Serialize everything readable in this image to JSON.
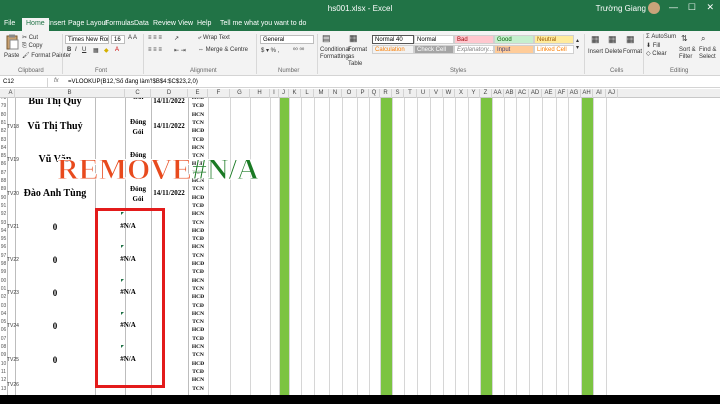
{
  "titlebar": {
    "title": "hs001.xlsx - Excel",
    "user": "Trường Giang",
    "min": "—",
    "max": "☐",
    "close": "✕"
  },
  "tabs": [
    "File",
    "Home",
    "Insert",
    "Page Layout",
    "Formulas",
    "Data",
    "Review",
    "View",
    "Help",
    "Tell me what you want to do"
  ],
  "ribbon": {
    "paste": "Paste",
    "cut": "Cut",
    "copy": "Copy",
    "format_painter": "Format Painter",
    "font_name": "Times New Roman",
    "font_size": "16",
    "wrap_text": "Wrap Text",
    "merge_center": "Merge & Centre",
    "number_format": "General",
    "cond_format": "Conditional Formatting",
    "format_table": "Format as Table",
    "styles": [
      {
        "label": "Normal 40",
        "bg": "#ffffff",
        "fg": "#000000"
      },
      {
        "label": "Normal",
        "bg": "#ffffff",
        "fg": "#000000"
      },
      {
        "label": "Bad",
        "bg": "#ffc7ce",
        "fg": "#9c0006"
      },
      {
        "label": "Good",
        "bg": "#c6efce",
        "fg": "#006100"
      },
      {
        "label": "Neutral",
        "bg": "#ffeb9c",
        "fg": "#9c5700"
      },
      {
        "label": "Calculation",
        "bg": "#f2f2f2",
        "fg": "#fa7d00"
      },
      {
        "label": "Check Cell",
        "bg": "#a5a5a5",
        "fg": "#ffffff"
      },
      {
        "label": "Explanatory...",
        "bg": "#ffffff",
        "fg": "#7f7f7f"
      },
      {
        "label": "Input",
        "bg": "#ffcc99",
        "fg": "#3f3f76"
      },
      {
        "label": "Linked Cell",
        "bg": "#ffffff",
        "fg": "#fa7d00"
      }
    ],
    "insert": "Insert",
    "delete": "Delete",
    "format": "Format",
    "autosum": "AutoSum",
    "fill": "Fill",
    "clear": "Clear",
    "sort_filter": "Sort & Filter",
    "find_select": "Find & Select",
    "groups": [
      "Clipboard",
      "Font",
      "Alignment",
      "Number",
      "Styles",
      "Cells",
      "Editing"
    ]
  },
  "formula_bar": {
    "name_box": "C12",
    "fx": "fx",
    "formula": "=VLOOKUP(B12,'Số đang làm'!$B$4:$C$23,2,0)"
  },
  "columns": [
    "A",
    "B",
    "C",
    "D",
    "E",
    "F",
    "G",
    "H",
    "I",
    "J",
    "K",
    "L",
    "M",
    "N",
    "O",
    "P",
    "Q",
    "R",
    "S",
    "T",
    "U",
    "V",
    "W",
    "X",
    "Y",
    "Z",
    "AA",
    "AB",
    "AC",
    "AD",
    "AE",
    "AF",
    "AG",
    "AH",
    "AI",
    "AJ"
  ],
  "overlay": {
    "remove": "REMOVE",
    "na": "#N/A"
  },
  "rows": [
    {
      "nums": [
        "78",
        "79"
      ],
      "stt": "",
      "name": "Bùi Thị Quý",
      "c": "Gói",
      "date": "14/11/2022",
      "codes": [
        "HCĐ",
        "TCĐ"
      ]
    },
    {
      "nums": [
        "80",
        "81",
        "82",
        "83"
      ],
      "stt": "TV18",
      "name": "Vũ Thị Thuỷ",
      "c": "Đóng Gói",
      "date": "14/11/2022",
      "codes": [
        "HCN",
        "TCN",
        "HCĐ",
        "TCĐ"
      ]
    },
    {
      "nums": [
        "84",
        "85",
        "86",
        "87"
      ],
      "stt": "TV19",
      "name": "Vũ Văn",
      "c": "Đóng",
      "date": "",
      "codes": [
        "HCN",
        "TCN",
        "HCĐ",
        "TCĐ"
      ]
    },
    {
      "nums": [
        "88",
        "89",
        "90",
        "91"
      ],
      "stt": "TV20",
      "name": "Đào Anh Tùng",
      "c": "Đóng Gói",
      "date": "14/11/2022",
      "codes": [
        "HCN",
        "TCN",
        "HCĐ",
        "TCĐ"
      ]
    },
    {
      "nums": [
        "92",
        "93",
        "94",
        "95"
      ],
      "stt": "TV21",
      "name": "0",
      "c": "#N/A",
      "date": "",
      "codes": [
        "HCN",
        "TCN",
        "HCĐ",
        "TCĐ"
      ]
    },
    {
      "nums": [
        "96",
        "97",
        "98",
        "99"
      ],
      "stt": "TV22",
      "name": "0",
      "c": "#N/A",
      "date": "",
      "codes": [
        "HCN",
        "TCN",
        "HCĐ",
        "TCĐ"
      ]
    },
    {
      "nums": [
        "00",
        "01",
        "02",
        "03"
      ],
      "stt": "TV23",
      "name": "0",
      "c": "#N/A",
      "date": "",
      "codes": [
        "HCN",
        "TCN",
        "HCĐ",
        "TCĐ"
      ]
    },
    {
      "nums": [
        "04",
        "05",
        "06",
        "07"
      ],
      "stt": "TV24",
      "name": "0",
      "c": "#N/A",
      "date": "",
      "codes": [
        "HCN",
        "TCN",
        "HCĐ",
        "TCĐ"
      ]
    },
    {
      "nums": [
        "08",
        "09",
        "10",
        "11"
      ],
      "stt": "TV25",
      "name": "0",
      "c": "#N/A",
      "date": "",
      "codes": [
        "HCN",
        "TCN",
        "HCĐ",
        "TCĐ"
      ]
    },
    {
      "nums": [
        "12",
        "13"
      ],
      "stt": "TV26",
      "name": "",
      "c": "",
      "date": "",
      "codes": [
        "HCN",
        "TCN"
      ]
    }
  ],
  "colors": {
    "excel_green": "#217346",
    "highlight_green": "#7cc442",
    "red_box": "#e31b1b",
    "remove_text": "#e84a1d",
    "na_text": "#1a7a24"
  }
}
